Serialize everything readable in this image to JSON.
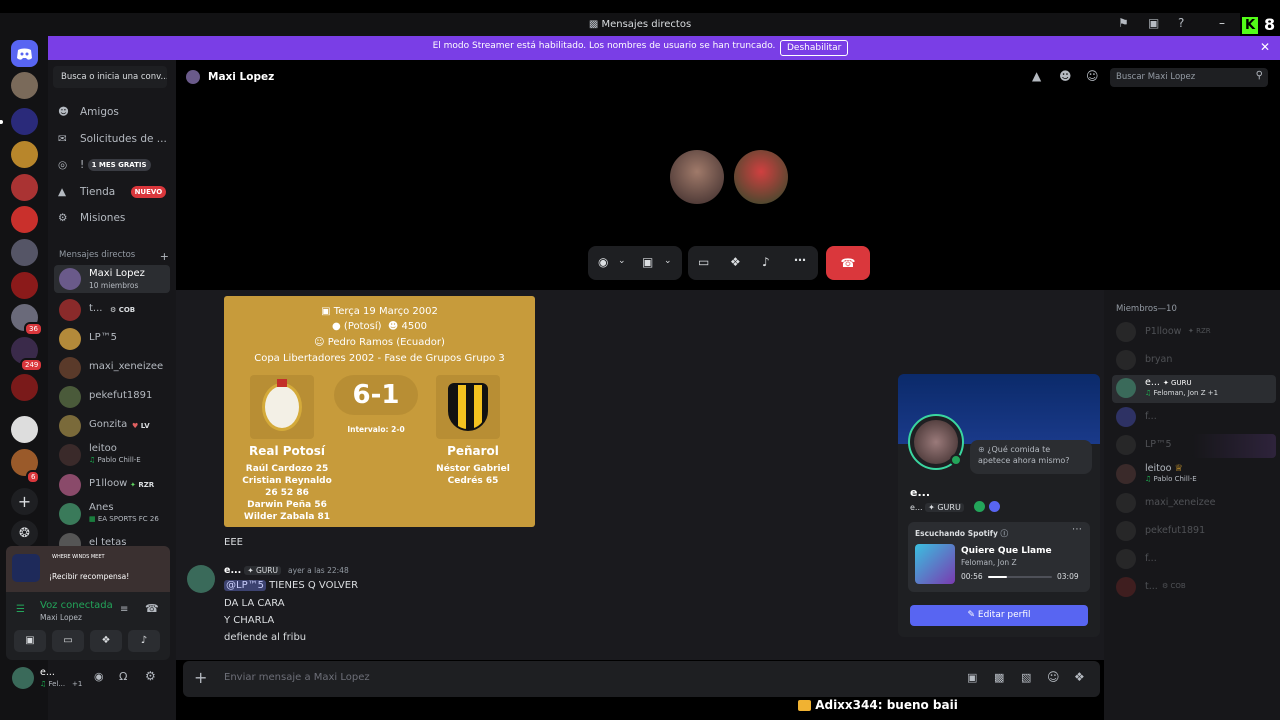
{
  "titlebar": {
    "title": "Mensajes directos"
  },
  "stream_badge": {
    "k": "K",
    "count": "8"
  },
  "banner": {
    "message": "El modo Streamer está habilitado. Los nombres de usuario se han truncado.",
    "button": "Deshabilitar"
  },
  "guilds": {
    "badges": [
      "36",
      "249",
      "6"
    ]
  },
  "sidebar": {
    "search_placeholder": "Busca o inicia una conv...",
    "nav": [
      {
        "label": "Amigos"
      },
      {
        "label": "Solicitudes de ..."
      },
      {
        "label": "!",
        "pill": "1 MES GRATIS"
      },
      {
        "label": "Tienda",
        "pill": "NUEVO"
      },
      {
        "label": "Misiones"
      }
    ],
    "dm_header": "Mensajes directos",
    "dms": [
      {
        "name": "Maxi Lopez",
        "sub": "10 miembros"
      },
      {
        "name": "t...",
        "tag": "COB"
      },
      {
        "name": "LP™5"
      },
      {
        "name": "maxi_xeneizee"
      },
      {
        "name": "pekefut1891"
      },
      {
        "name": "Gonzita",
        "tag": "LV"
      },
      {
        "name": "leitoo",
        "sub": "Pablo Chill-E"
      },
      {
        "name": "P1lloow",
        "tag": "RZR"
      },
      {
        "name": "Anes",
        "sub": "EA SPORTS FC 26"
      },
      {
        "name": "el tetas"
      }
    ],
    "promo": {
      "title": "WHERE WINDS MEET",
      "text": "¡Recibir recompensa!"
    },
    "voice": {
      "status": "Voz conectada",
      "channel": "Maxi Lopez"
    },
    "user": {
      "name": "e...",
      "sub": "Fel...",
      "extra": "+1"
    }
  },
  "chat": {
    "title": "Maxi Lopez",
    "search_placeholder": "Buscar Maxi Lopez",
    "composer_placeholder": "Enviar mensaje a Maxi Lopez"
  },
  "match_card": {
    "date": "Terça 19 Março 2002",
    "city": "(Potosí)",
    "attendance": "4500",
    "referee": "Pedro Ramos (Ecuador)",
    "competition": "Copa Libertadores 2002 - Fase de Grupos Grupo 3",
    "score": "6-1",
    "halftime": "Intervalo: 2-0",
    "home": {
      "name": "Real Potosí",
      "scorers": [
        "Raúl Cardozo 25",
        "Cristian Reynaldo",
        "26 52 86",
        "Darwin Peña 56",
        "Wilder Zabala 81"
      ]
    },
    "away": {
      "name": "Peñarol",
      "scorers": [
        "Néstor Gabriel",
        "Cedrés 65"
      ]
    }
  },
  "messages": {
    "first": "EEE",
    "author": "e...",
    "author_tag": "GURU",
    "time": "ayer a las 22:48",
    "mention": "@LP™5",
    "lines": [
      "TIENES Q VOLVER",
      "DA LA CARA",
      "Y CHARLA",
      "defiende al fribu"
    ]
  },
  "members": {
    "header": "Miembros—10",
    "list": [
      {
        "name": "P1lloow",
        "tag": "RZR",
        "sub": "",
        "highlight": false
      },
      {
        "name": "bryan",
        "tag": "",
        "sub": "",
        "highlight": false
      },
      {
        "name": "e...",
        "tag": "GURU",
        "sub": "Feloman, Jon Z +1",
        "highlight": true
      },
      {
        "name": "f...",
        "tag": "",
        "sub": "",
        "highlight": false
      },
      {
        "name": "LP™5",
        "tag": "",
        "sub": "",
        "highlight": false
      },
      {
        "name": "leitoo",
        "tag": "",
        "sub": "Pablo Chill-E",
        "highlight": false
      },
      {
        "name": "maxi_xeneizee",
        "tag": "",
        "sub": "",
        "highlight": false
      },
      {
        "name": "pekefut1891",
        "tag": "",
        "sub": "",
        "highlight": false
      },
      {
        "name": "f...",
        "tag": "",
        "sub": "",
        "highlight": false
      },
      {
        "name": "t...",
        "tag": "COB",
        "sub": "",
        "highlight": false
      }
    ]
  },
  "profile_popup": {
    "status": "¿Qué comida te apetece ahora mismo?",
    "name": "e...",
    "sub": "e...",
    "tag": "GURU",
    "listening": "Escuchando Spotify",
    "song": "Quiere Que Llame",
    "artist": "Feloman, Jon Z",
    "time_current": "00:56",
    "time_total": "03:09",
    "progress": 0.3,
    "edit_button": "Editar perfil"
  },
  "stream_chat": {
    "user": "Adixx344",
    "message": ": bueno baii"
  },
  "colors": {
    "banner": "#7a3ee6",
    "card": "#c79b3b",
    "hangup": "#da373c",
    "accent": "#5865f2",
    "online": "#23a55a"
  }
}
